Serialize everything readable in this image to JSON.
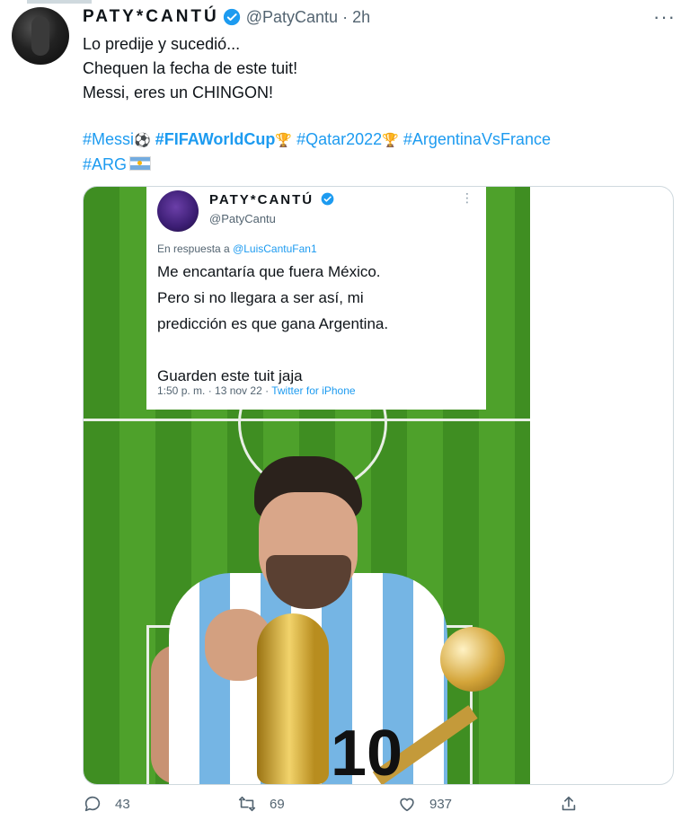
{
  "tweet": {
    "author_name": "PATY*CANTÚ",
    "author_handle": "@PatyCantu",
    "separator": "·",
    "time": "2h",
    "more_glyph": "···",
    "lines": [
      "Lo predije y sucedió...",
      "Chequen la fecha de este tuit!",
      "Messi, eres un CHINGON!"
    ],
    "hashtags": {
      "messi": "#Messi",
      "messi_emoji": "⚽",
      "fifa": "#FIFAWorldCup",
      "fifa_emoji": "🏆",
      "qatar": "#Qatar2022",
      "qatar_emoji": "🏆",
      "arg_vs_fra": "#ArgentinaVsFrance",
      "arg": "#ARG"
    }
  },
  "quoted": {
    "author_name": "PATY*CANTÚ",
    "author_handle": "@PatyCantu",
    "more_glyph": "⋮",
    "reply_prefix": "En respuesta a",
    "reply_mention": "@LuisCantuFan1",
    "body": [
      "Me encantaría que fuera México.",
      "Pero si no llegara a ser así, mi",
      "predicción es que gana Argentina.",
      "",
      "Guarden este tuit jaja"
    ],
    "meta_time": "1:50 p. m. · 13 nov 22 · ",
    "meta_source": "Twitter for iPhone"
  },
  "jersey_number": "10",
  "actions": {
    "reply_count": "43",
    "retweet_count": "69",
    "like_count": "937"
  },
  "colors": {
    "link": "#1d9bf0",
    "secondary_text": "#536471",
    "verified": "#1d9bf0"
  }
}
